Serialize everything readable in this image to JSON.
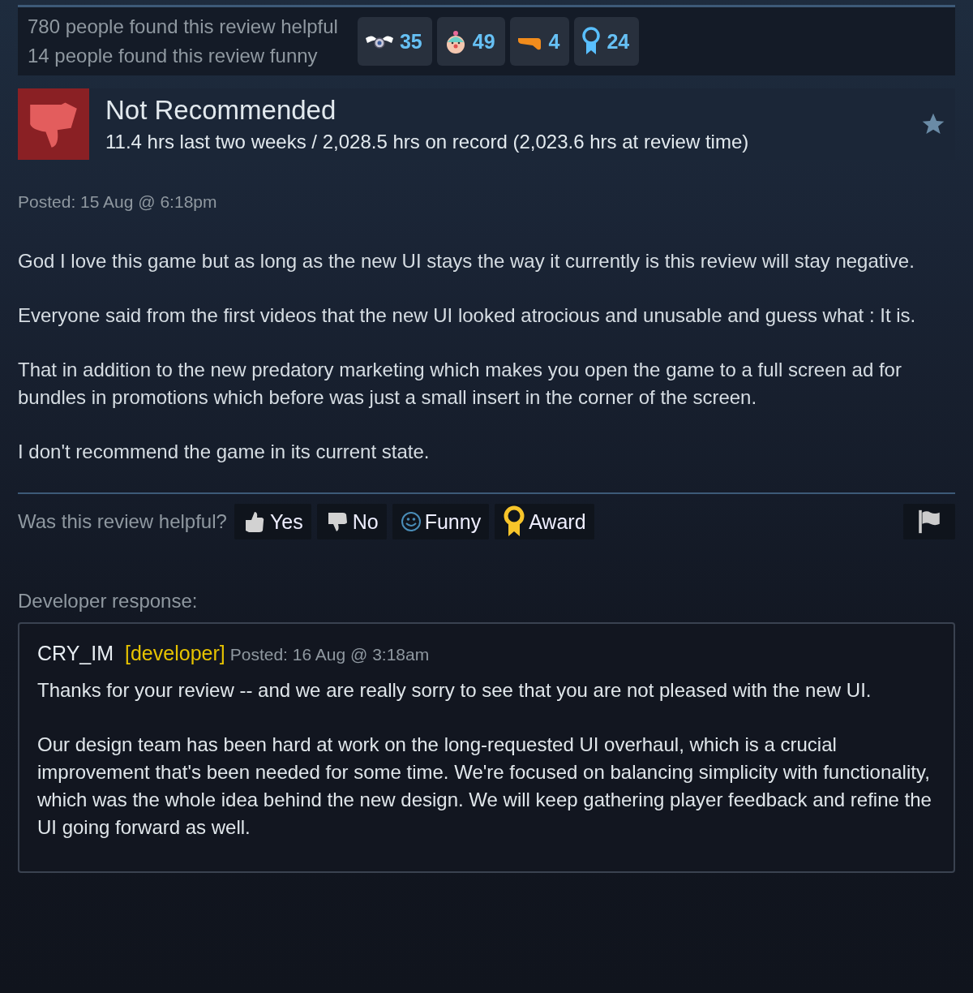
{
  "summary": {
    "helpful": "780 people found this review helpful",
    "funny": "14 people found this review funny",
    "awards": [
      {
        "kind": "angel",
        "count": "35"
      },
      {
        "kind": "clown",
        "count": "49"
      },
      {
        "kind": "pistol",
        "count": "4"
      },
      {
        "kind": "ribbon",
        "count": "24"
      }
    ]
  },
  "review": {
    "recommended": false,
    "verdict": "Not Recommended",
    "hours": "11.4 hrs last two weeks / 2,028.5 hrs on record (2,023.6 hrs at review time)",
    "posted": "Posted: 15 Aug @ 6:18pm",
    "paragraphs": [
      "God I love this game but as long as the new UI stays the way it currently is this review will stay negative.",
      "Everyone said from the first videos that the new UI looked atrocious and unusable and guess what : It is.",
      "That in addition to the new predatory marketing which makes you open the game to a full screen ad for bundles in promotions which before was just a small insert in the corner of the screen.",
      "I don't recommend the game in its current state."
    ]
  },
  "vote_bar": {
    "question": "Was this review helpful?",
    "buttons": [
      {
        "kind": "yes",
        "label": "Yes"
      },
      {
        "kind": "no",
        "label": "No"
      },
      {
        "kind": "funny",
        "label": "Funny"
      },
      {
        "kind": "award",
        "label": "Award"
      }
    ]
  },
  "developer_response": {
    "heading": "Developer response:",
    "author": "CRY_IM",
    "badge": "[developer]",
    "posted": "Posted: 16 Aug @ 3:18am",
    "paragraphs": [
      "Thanks for your review -- and we are really sorry to see that you are not pleased with the new UI.",
      "Our design team has been hard at work on the long-requested UI overhaul, which is a crucial improvement that's been needed for some time. We're focused on balancing simplicity with functionality, which was the whole idea behind the new design. We will keep gathering player feedback and refine the UI going forward as well."
    ]
  }
}
